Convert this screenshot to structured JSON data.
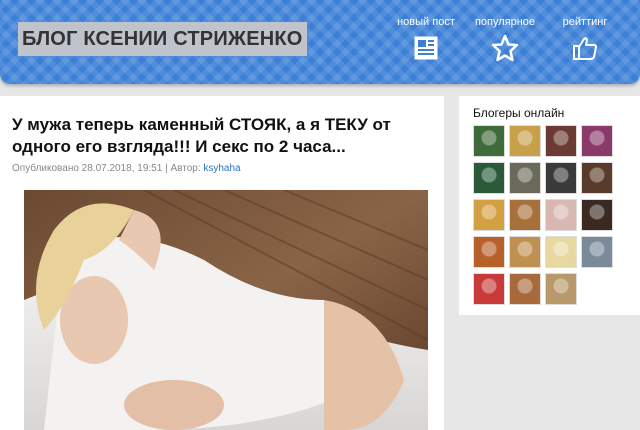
{
  "header": {
    "logo": "БЛОГ КСЕНИИ СТРИЖЕНКО",
    "nav": [
      {
        "label": "новый пост",
        "icon": "newspaper-icon"
      },
      {
        "label": "популярное",
        "icon": "star-icon"
      },
      {
        "label": "рейттинг",
        "icon": "thumbs-up-icon"
      }
    ]
  },
  "article": {
    "title": "У мужа теперь каменный СТОЯК, а я ТЕКУ от одного его взгляда!!! И секс по 2 часа...",
    "published_label": "Опубликовано 28.07.2018, 19:51 | Автор: ",
    "author": "ksyhaha"
  },
  "sidebar": {
    "title": "Блогеры онлайн",
    "avatars": [
      "#3f6a3a",
      "#c8a04a",
      "#6b3a32",
      "#8a3a6a",
      "#2a5a3a",
      "#6a6a5a",
      "#3a3a3a",
      "#5a3a2a",
      "#d2a040",
      "#a8703a",
      "#d8b8b0",
      "#3a2a22",
      "#b8602a",
      "#c09050",
      "#e8d8a0",
      "#7a8a9a",
      "#c83a3a",
      "#a86a3a",
      "#b89a6a"
    ]
  },
  "colors": {
    "header_bg": "#3b7fd6",
    "accent": "#2d72c4"
  }
}
